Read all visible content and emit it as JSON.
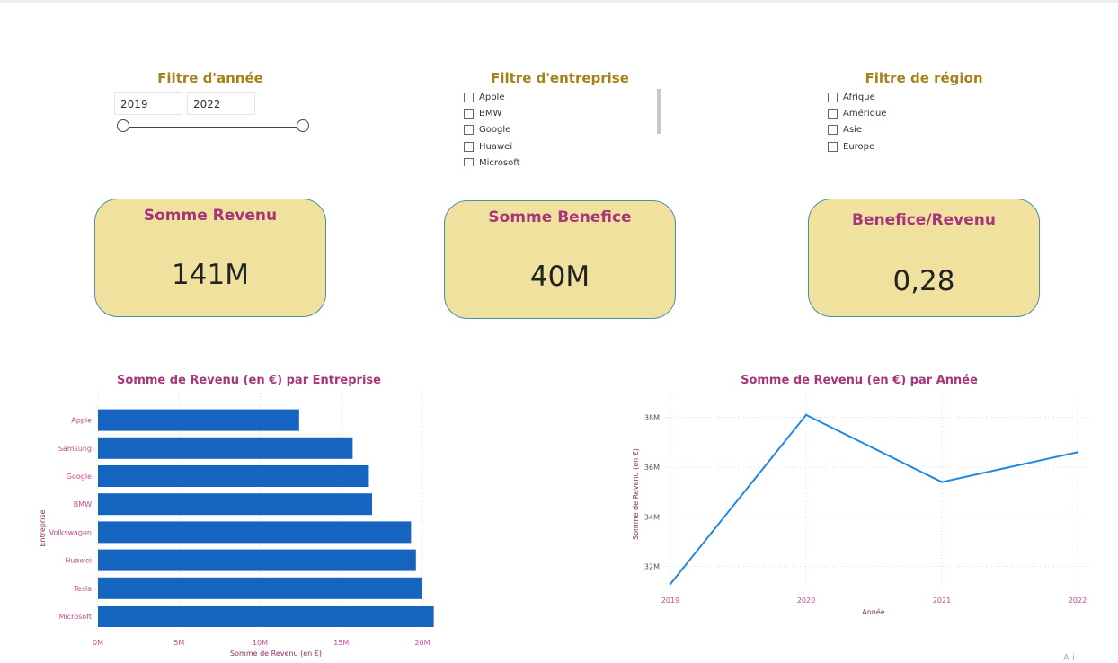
{
  "slicers": {
    "year": {
      "title": "Filtre d'année",
      "from": "2019",
      "to": "2022"
    },
    "company": {
      "title": "Filtre d'entreprise",
      "items": [
        "Apple",
        "BMW",
        "Google",
        "Huawei",
        "Microsoft"
      ]
    },
    "region": {
      "title": "Filtre de région",
      "items": [
        "Afrique",
        "Amérique",
        "Asie",
        "Europe"
      ]
    }
  },
  "kpis": [
    {
      "title": "Somme Revenu",
      "value": "141M"
    },
    {
      "title": "Somme Benefice",
      "value": "40M"
    },
    {
      "title": "Benefice/Revenu",
      "value": "0,28"
    }
  ],
  "chart_data": [
    {
      "type": "bar",
      "orientation": "horizontal",
      "title": "Somme de Revenu (en €) par Entreprise",
      "xlabel": "Somme de Revenu (en €)",
      "ylabel": "Entreprise",
      "categories": [
        "Apple",
        "Samsung",
        "Google",
        "BMW",
        "Volkswagen",
        "Huawei",
        "Tesla",
        "Microsoft"
      ],
      "values": [
        12.4,
        15.7,
        16.7,
        16.9,
        19.3,
        19.6,
        20.0,
        20.7
      ],
      "unit": "M",
      "xlim": [
        0,
        20
      ],
      "xticks": [
        "0M",
        "5M",
        "10M",
        "15M",
        "20M"
      ],
      "grid": true,
      "color": "#1565c0"
    },
    {
      "type": "line",
      "title": "Somme de Revenu (en €) par Année",
      "xlabel": "Année",
      "ylabel": "Somme de Revenu (en €)",
      "x": [
        "2019",
        "2020",
        "2021",
        "2022"
      ],
      "values": [
        31.3,
        38.1,
        35.4,
        36.6
      ],
      "unit": "M",
      "ylim": [
        31.3,
        38.6
      ],
      "yticks": [
        "32M",
        "34M",
        "36M",
        "38M"
      ],
      "grid": true,
      "color": "#1e88e5"
    }
  ],
  "footer_text": "A  i"
}
